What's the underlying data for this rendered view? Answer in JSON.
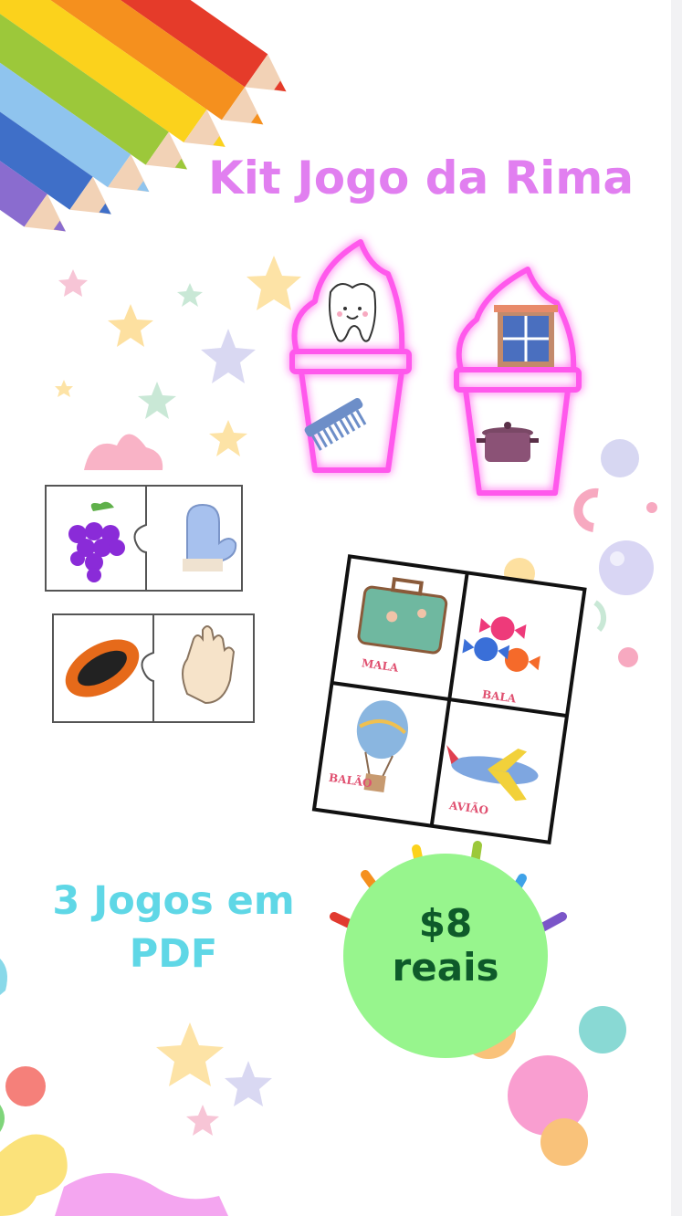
{
  "title": "Kit Jogo da Rima",
  "subtitle_line1": "3 Jogos em",
  "subtitle_line2": "PDF",
  "price_line1": "$8",
  "price_line2": "reais",
  "cards": [
    "MALA",
    "BALA",
    "BALÃO",
    "AVIÃO"
  ],
  "colors": {
    "title": "#e17ff0",
    "subtitle": "#5fd7e6",
    "price_bg": "#97f58d",
    "price_text": "#0e5a2a",
    "neon": "#ff4de8"
  },
  "icons": [
    "pencils-icon",
    "star-icon",
    "ice-cream-neon-icon",
    "tooth-icon",
    "comb-icon",
    "window-icon",
    "pot-icon",
    "grapes-icon",
    "mitten-icon",
    "papaya-icon",
    "hand-icon",
    "suitcase-icon",
    "candy-icon",
    "hot-air-balloon-icon",
    "airplane-icon",
    "paint-splash-icon"
  ]
}
